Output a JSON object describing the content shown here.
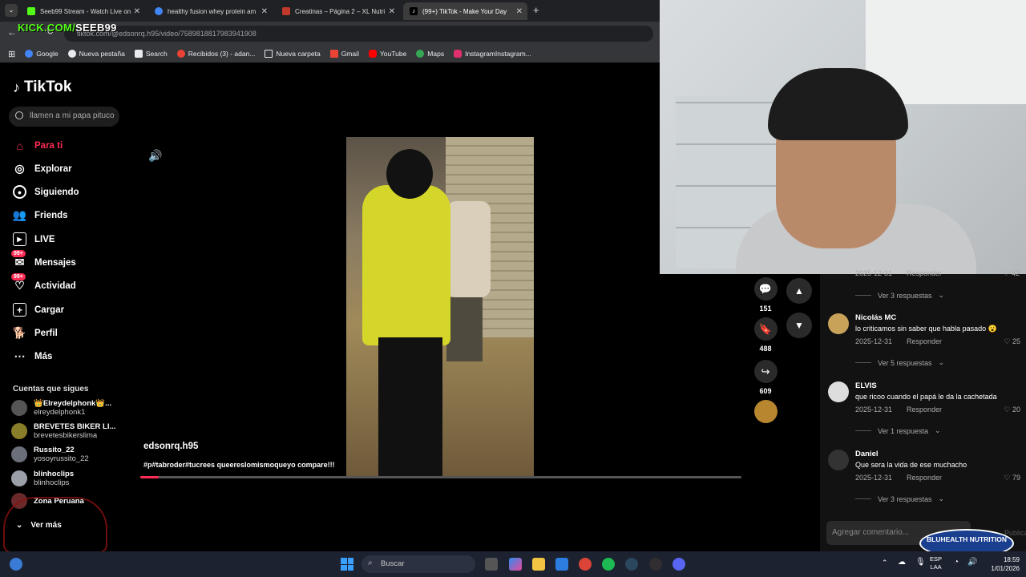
{
  "browser": {
    "tabs": [
      {
        "label": "Seeb99 Stream - Watch Live on",
        "color": "#53fc18"
      },
      {
        "label": "healthy fusion whey protein am",
        "color": "#4285f4"
      },
      {
        "label": "Creatinas – Página 2 – XL Nutri",
        "color": "#c0392b"
      },
      {
        "label": "(99+) TikTok - Make Your Day",
        "color": "#ffffff"
      }
    ],
    "url": "tiktok.com/@edsonrq.h95/video/7589818817983941908",
    "overlay_kick": "KICK.COM/",
    "overlay_channel": "SEEB99",
    "bookmarks": [
      {
        "label": "Google",
        "color": "#4285f4"
      },
      {
        "label": "Nueva pestaña",
        "color": "#e8eaed"
      },
      {
        "label": "Search",
        "color": "#e8eaed"
      },
      {
        "label": "Recibidos (3) - adan...",
        "color": "#ea4335"
      },
      {
        "label": "Nueva carpeta",
        "color": "#e8eaed"
      },
      {
        "label": "Gmail",
        "color": "#ea4335"
      },
      {
        "label": "YouTube",
        "color": "#ff0000"
      },
      {
        "label": "Maps",
        "color": "#34a853"
      },
      {
        "label": "InstagramInstagram...",
        "color": "#e1306c"
      }
    ]
  },
  "tiktok": {
    "logo": "TikTok",
    "search_placeholder": "llamen a mi papa pituco",
    "nav": [
      {
        "label": "Para ti",
        "icon": "home-icon",
        "active": true
      },
      {
        "label": "Explorar",
        "icon": "compass-icon"
      },
      {
        "label": "Siguiendo",
        "icon": "following-icon"
      },
      {
        "label": "Friends",
        "icon": "friends-icon"
      },
      {
        "label": "LIVE",
        "icon": "live-icon"
      },
      {
        "label": "Mensajes",
        "icon": "messages-icon",
        "badge": "99+"
      },
      {
        "label": "Actividad",
        "icon": "activity-icon",
        "badge": "99+"
      },
      {
        "label": "Cargar",
        "icon": "upload-icon"
      },
      {
        "label": "Perfil",
        "icon": "profile-icon"
      },
      {
        "label": "Más",
        "icon": "more-icon"
      }
    ],
    "following_title": "Cuentas que sigues",
    "following": [
      {
        "name": "👑Elreydelphonk👑...",
        "handle": "elreydelphonk1"
      },
      {
        "name": "BREVETES BIKER LI...",
        "handle": "brevetesbikerslima"
      },
      {
        "name": "Russito_22",
        "handle": "yosoyrussito_22"
      },
      {
        "name": "blinhoclips",
        "handle": "blinhoclips"
      },
      {
        "name": "Zona Peruana",
        "handle": ""
      }
    ],
    "see_more": "Ver más",
    "video": {
      "username": "edsonrq.h95",
      "caption": "#p#tabroder#tucrees queereslomismoqueyo compare!!!",
      "progress": 0.03
    },
    "actions": [
      {
        "icon": "comment-icon",
        "count": "151"
      },
      {
        "icon": "bookmark-icon",
        "count": "488"
      },
      {
        "icon": "share-icon",
        "count": "609"
      }
    ]
  },
  "comments": {
    "top_item": {
      "date": "2025-12-31",
      "reply": "Responder",
      "likes": "42",
      "more": "Ver 3 respuestas"
    },
    "items": [
      {
        "name": "Nicolás MC",
        "text": "lo criticamos sin saber que habla pasado 😮",
        "date": "2025-12-31",
        "reply": "Responder",
        "likes": "25",
        "more": "Ver 5 respuestas"
      },
      {
        "name": "ELVIS",
        "text": "que ricoo cuando el papá le da la cachetada",
        "date": "2025-12-31",
        "reply": "Responder",
        "likes": "20",
        "more": "Ver 1 respuesta"
      },
      {
        "name": "Daniel",
        "text": "Que sera la vida de ese muchacho",
        "date": "2025-12-31",
        "reply": "Responder",
        "likes": "79",
        "more": "Ver 3 respuestas"
      }
    ],
    "add_placeholder": "Agregar comentario...",
    "publish": "Publicar",
    "sponsor": "BLUHEALTH NUTRITION"
  },
  "taskbar": {
    "search_label": "Buscar",
    "lang1": "ESP",
    "lang2": "LAA",
    "time": "18:59",
    "date": "1/01/2026"
  }
}
